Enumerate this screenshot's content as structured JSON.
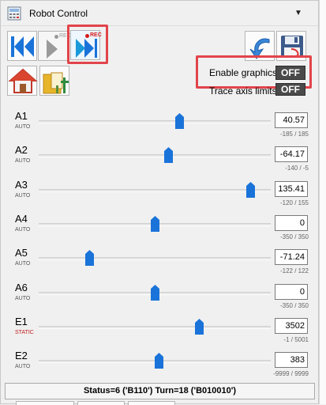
{
  "window": {
    "title": "Robot Control"
  },
  "toolbar": {
    "rec_label": "REC",
    "rec_label_disabled": "REC"
  },
  "options": {
    "enable_graphics_label": "Enable graphics",
    "enable_graphics_value": "OFF",
    "trace_axis_label": "Trace axis limits",
    "trace_axis_value": "OFF"
  },
  "axes": [
    {
      "name": "A1",
      "mode": "AUTO",
      "value": "40.57",
      "range": "-185 / 185",
      "min": -185,
      "max": 185,
      "position": 40.57
    },
    {
      "name": "A2",
      "mode": "AUTO",
      "value": "-64.17",
      "range": "-140 / -5",
      "min": -140,
      "max": -5,
      "position": -64.17
    },
    {
      "name": "A3",
      "mode": "AUTO",
      "value": "135.41",
      "range": "-120 / 155",
      "min": -120,
      "max": 155,
      "position": 135.41
    },
    {
      "name": "A4",
      "mode": "AUTO",
      "value": "0",
      "range": "-350 / 350",
      "min": -350,
      "max": 350,
      "position": 0
    },
    {
      "name": "A5",
      "mode": "AUTO",
      "value": "-71.24",
      "range": "-122 / 122",
      "min": -122,
      "max": 122,
      "position": -71.24
    },
    {
      "name": "A6",
      "mode": "AUTO",
      "value": "0",
      "range": "-350 / 350",
      "min": -350,
      "max": 350,
      "position": 0
    },
    {
      "name": "E1",
      "mode": "STATIC",
      "value": "3502",
      "range": "-1 / 5001",
      "min": -1,
      "max": 5001,
      "position": 3502
    },
    {
      "name": "E2",
      "mode": "AUTO",
      "value": "383",
      "range": "-9999 / 9999",
      "min": -9999,
      "max": 9999,
      "position": 383
    }
  ],
  "status": {
    "text": "Status=6 ('B110') Turn=18 ('B010010')"
  },
  "colors": {
    "accent": "#1a73d9",
    "highlight": "#e2444b",
    "toggle_bg": "#4a4a4a"
  }
}
